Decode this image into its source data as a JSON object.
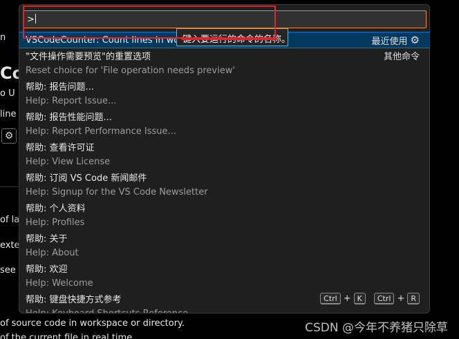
{
  "background": {
    "text_co": "Co",
    "text_u": "o U",
    "text_line": "line",
    "text_of_la": "of la",
    "text_exte": "exte",
    "text_see": "see t",
    "text_n": "n",
    "bottom_line1": "of source code in workspace or directory.",
    "bottom_line2": "of the current file in real time.",
    "gear_glyph": "⚙"
  },
  "watermark": "CSDN @今年不养猪只除草",
  "palette": {
    "input_value": ">",
    "tooltip": "键入要运行的命令的名称。",
    "items": [
      {
        "title": "VSCodeCounter: Count lines in workspace",
        "right": "最近使用",
        "gear": "⚙",
        "focused": true
      },
      {
        "title": "\"文件操作需要预览\"的重置选项",
        "right": "其他命令",
        "sub": "Reset choice for 'File operation needs preview'"
      },
      {
        "title": "帮助: 报告问题...",
        "sub": "Help: Report Issue..."
      },
      {
        "title": "帮助: 报告性能问题...",
        "sub": "Help: Report Performance Issue..."
      },
      {
        "title": "帮助: 查看许可证",
        "sub": "Help: View License"
      },
      {
        "title": "帮助: 订阅 VS Code 新闻邮件",
        "sub": "Help: Signup for the VS Code Newsletter"
      },
      {
        "title": "帮助: 个人资料",
        "sub": "Help: Profiles"
      },
      {
        "title": "帮助: 关于",
        "sub": "Help: About"
      },
      {
        "title": "帮助: 欢迎",
        "sub": "Help: Welcome"
      },
      {
        "title": "帮助: 键盘快捷方式参考",
        "sub": "Help: Keyboard Shortcuts Reference",
        "keys": [
          "Ctrl",
          "+",
          "K",
          "Ctrl",
          "+",
          "R"
        ]
      }
    ]
  }
}
